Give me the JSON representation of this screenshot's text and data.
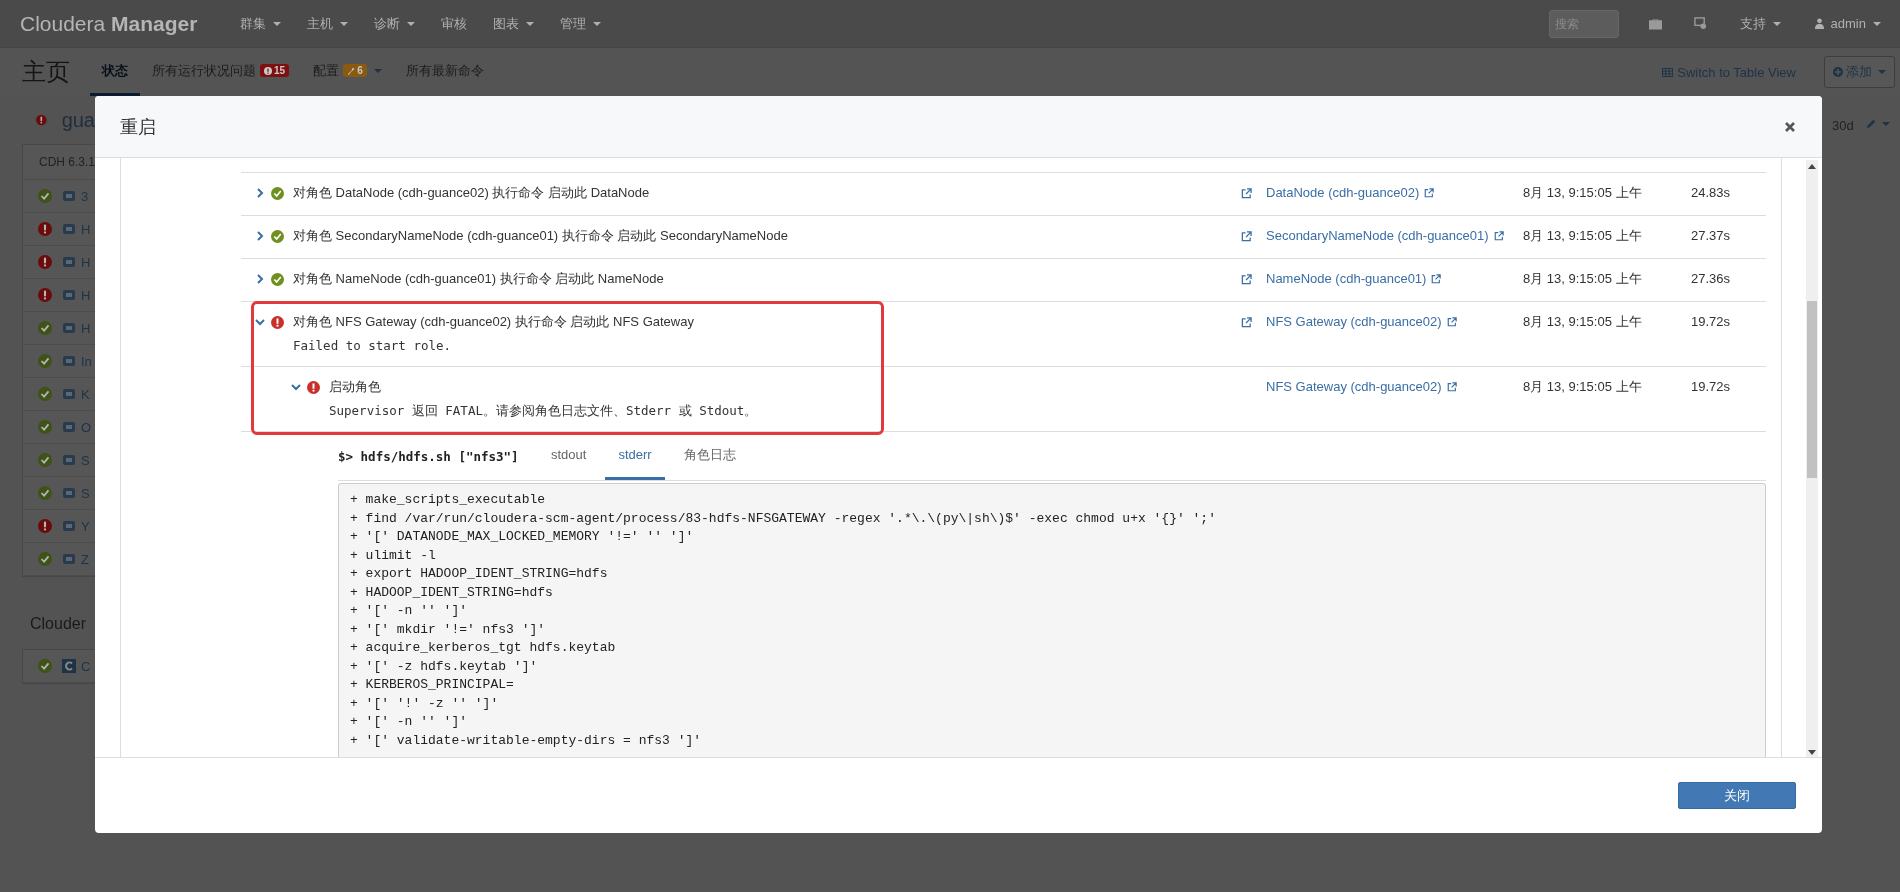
{
  "navbar": {
    "brand_light": "Cloudera",
    "brand_bold": "Manager",
    "menus": [
      {
        "label": "群集",
        "dropdown": true
      },
      {
        "label": "主机",
        "dropdown": true
      },
      {
        "label": "诊断",
        "dropdown": true
      },
      {
        "label": "审核",
        "dropdown": false
      },
      {
        "label": "图表",
        "dropdown": true
      },
      {
        "label": "管理",
        "dropdown": true
      }
    ],
    "search": {
      "placeholder": "搜索"
    },
    "support": "支持",
    "user": "admin"
  },
  "subnav": {
    "title": "主页",
    "tabs": [
      {
        "label": "状态",
        "selected": true
      },
      {
        "label": "所有运行状况问题",
        "selected": false,
        "badge": "15",
        "kind": "error",
        "dropdown": false
      },
      {
        "label": "配置",
        "selected": false,
        "badge": "6",
        "kind": "warning",
        "dropdown": true
      },
      {
        "label": "所有最新命令",
        "selected": false
      }
    ],
    "table_view": "Switch to Table View",
    "add": "添加"
  },
  "cluster": {
    "failed": true,
    "name": "gua",
    "version": "CDH 6.3.1",
    "services": [
      {
        "failed": false,
        "label": "3"
      },
      {
        "failed": true,
        "label": "H"
      },
      {
        "failed": true,
        "label": "H"
      },
      {
        "failed": true,
        "label": "H"
      },
      {
        "failed": false,
        "label": "H"
      },
      {
        "failed": false,
        "label": "In"
      },
      {
        "failed": false,
        "label": "K"
      },
      {
        "failed": false,
        "label": "O"
      },
      {
        "failed": false,
        "label": "S"
      },
      {
        "failed": false,
        "label": "S"
      },
      {
        "failed": true,
        "label": "Y"
      },
      {
        "failed": false,
        "label": "Z"
      }
    ]
  },
  "management": {
    "title": "Clouder",
    "services": [
      {
        "failed": false,
        "label": "C"
      }
    ]
  },
  "right_panel": {
    "range": "30d"
  },
  "modal": {
    "title": "重启",
    "rows": [
      {
        "failed": false,
        "expanded": false,
        "highlighted": false,
        "text": "对角色 DataNode (cdh-guance02) 执行命令 启动此 DataNode",
        "external": true,
        "link": "DataNode (cdh-guance02)",
        "time": "8月 13, 9:15:05 上午",
        "duration": "24.83s"
      },
      {
        "failed": false,
        "expanded": false,
        "highlighted": false,
        "text": "对角色 SecondaryNameNode (cdh-guance01) 执行命令 启动此 SecondaryNameNode",
        "external": true,
        "link": "SecondaryNameNode (cdh-guance01)",
        "time": "8月 13, 9:15:05 上午",
        "duration": "27.37s"
      },
      {
        "failed": false,
        "expanded": false,
        "highlighted": false,
        "text": "对角色 NameNode (cdh-guance01) 执行命令 启动此 NameNode",
        "external": true,
        "link": "NameNode (cdh-guance01)",
        "time": "8月 13, 9:15:05 上午",
        "duration": "27.36s"
      },
      {
        "failed": true,
        "expanded": true,
        "highlighted": true,
        "text": "对角色 NFS Gateway (cdh-guance02) 执行命令 启动此 NFS Gateway",
        "detail": "Failed to start role.",
        "external": true,
        "link": "NFS Gateway (cdh-guance02)",
        "time": "8月 13, 9:15:05 上午",
        "duration": "19.72s",
        "children": [
          {
            "failed": true,
            "expanded": true,
            "text": "启动角色",
            "detail": "Supervisor 返回 FATAL。请参阅角色日志文件、Stderr 或 Stdout。",
            "external": false,
            "link": "NFS Gateway (cdh-guance02)",
            "time": "8月 13, 9:15:05 上午",
            "duration": "19.72s"
          }
        ]
      }
    ],
    "command": {
      "prompt": "$>",
      "text": "hdfs/hdfs.sh [\"nfs3\"]",
      "tabs": [
        {
          "label": "stdout",
          "selected": false
        },
        {
          "label": "stderr",
          "selected": true
        },
        {
          "label": "角色日志",
          "selected": false
        }
      ],
      "lines": [
        "+ make_scripts_executable",
        "+ find /var/run/cloudera-scm-agent/process/83-hdfs-NFSGATEWAY -regex '.*\\.\\(py\\|sh\\)$' -exec chmod u+x '{}' ';'",
        "+ '[' DATANODE_MAX_LOCKED_MEMORY '!=' '' ']'",
        "+ ulimit -l",
        "+ export HADOOP_IDENT_STRING=hdfs",
        "+ HADOOP_IDENT_STRING=hdfs",
        "+ '[' -n '' ']'",
        "+ '[' mkdir '!=' nfs3 ']'",
        "+ acquire_kerberos_tgt hdfs.keytab",
        "+ '[' -z hdfs.keytab ']'",
        "+ KERBEROS_PRINCIPAL=",
        "+ '[' '!' -z '' ']'",
        "+ '[' -n '' ']'",
        "+ '[' validate-writable-empty-dirs = nfs3 ']'"
      ]
    },
    "close_button": "关闭"
  }
}
